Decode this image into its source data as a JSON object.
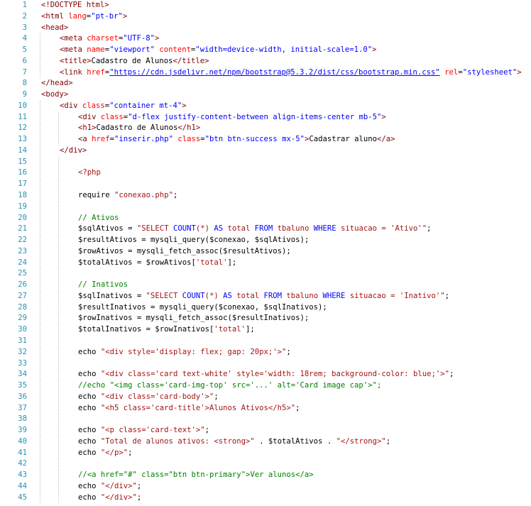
{
  "editor": {
    "colors": {
      "line_number": "#2b91af",
      "tag": "#800000",
      "attribute": "#ff0000",
      "string": "#0000ff",
      "comment": "#008000",
      "text": "#000000",
      "background": "#ffffff"
    },
    "lines": [
      {
        "n": "1",
        "tokens": [
          {
            "t": "tag",
            "v": "<!DOCTYPE html>"
          }
        ]
      },
      {
        "n": "2",
        "tokens": [
          {
            "t": "tag",
            "v": "<html "
          },
          {
            "t": "attr",
            "v": "lang"
          },
          {
            "t": "txt",
            "v": "="
          },
          {
            "t": "str",
            "v": "\"pt-br\""
          },
          {
            "t": "tag",
            "v": ">"
          }
        ]
      },
      {
        "n": "3",
        "tokens": [
          {
            "t": "tag",
            "v": "<head>"
          }
        ]
      },
      {
        "n": "4",
        "indent": 1,
        "tokens": [
          {
            "t": "tag",
            "v": "<meta "
          },
          {
            "t": "attr",
            "v": "charset"
          },
          {
            "t": "txt",
            "v": "="
          },
          {
            "t": "str",
            "v": "\"UTF-8\""
          },
          {
            "t": "tag",
            "v": ">"
          }
        ]
      },
      {
        "n": "5",
        "indent": 1,
        "tokens": [
          {
            "t": "tag",
            "v": "<meta "
          },
          {
            "t": "attr",
            "v": "name"
          },
          {
            "t": "txt",
            "v": "="
          },
          {
            "t": "str",
            "v": "\"viewport\""
          },
          {
            "t": "txt",
            "v": " "
          },
          {
            "t": "attr",
            "v": "content"
          },
          {
            "t": "txt",
            "v": "="
          },
          {
            "t": "str",
            "v": "\"width=device-width, initial-scale=1.0\""
          },
          {
            "t": "tag",
            "v": ">"
          }
        ]
      },
      {
        "n": "6",
        "indent": 1,
        "tokens": [
          {
            "t": "tag",
            "v": "<title>"
          },
          {
            "t": "txt",
            "v": "Cadastro de Alunos"
          },
          {
            "t": "tag",
            "v": "</title>"
          }
        ]
      },
      {
        "n": "7",
        "indent": 1,
        "tokens": [
          {
            "t": "tag",
            "v": "<link "
          },
          {
            "t": "attr",
            "v": "href"
          },
          {
            "t": "txt",
            "v": "="
          },
          {
            "t": "url",
            "v": "\"https://cdn.jsdelivr.net/npm/bootstrap@5.3.2/dist/css/bootstrap.min.css\""
          },
          {
            "t": "txt",
            "v": " "
          },
          {
            "t": "attr",
            "v": "rel"
          },
          {
            "t": "txt",
            "v": "="
          },
          {
            "t": "str",
            "v": "\"stylesheet\""
          },
          {
            "t": "tag",
            "v": ">"
          }
        ]
      },
      {
        "n": "8",
        "tokens": [
          {
            "t": "tag",
            "v": "</head>"
          }
        ]
      },
      {
        "n": "9",
        "tokens": [
          {
            "t": "tag",
            "v": "<body>"
          }
        ]
      },
      {
        "n": "10",
        "indent": 1,
        "tokens": [
          {
            "t": "tag",
            "v": "<div "
          },
          {
            "t": "attr",
            "v": "class"
          },
          {
            "t": "txt",
            "v": "="
          },
          {
            "t": "str",
            "v": "\"container mt-4\""
          },
          {
            "t": "tag",
            "v": ">"
          }
        ]
      },
      {
        "n": "11",
        "indent": 2,
        "tokens": [
          {
            "t": "tag",
            "v": "<div "
          },
          {
            "t": "attr",
            "v": "class"
          },
          {
            "t": "txt",
            "v": "="
          },
          {
            "t": "str",
            "v": "\"d-flex justify-content-between align-items-center mb-5\""
          },
          {
            "t": "tag",
            "v": ">"
          }
        ]
      },
      {
        "n": "12",
        "indent": 2,
        "tokens": [
          {
            "t": "tag",
            "v": "<h1>"
          },
          {
            "t": "txt",
            "v": "Cadastro de Alunos"
          },
          {
            "t": "tag",
            "v": "</h1>"
          }
        ]
      },
      {
        "n": "13",
        "indent": 2,
        "tokens": [
          {
            "t": "tag",
            "v": "<a "
          },
          {
            "t": "attr",
            "v": "href"
          },
          {
            "t": "txt",
            "v": "="
          },
          {
            "t": "str",
            "v": "\"inserir.php\""
          },
          {
            "t": "txt",
            "v": " "
          },
          {
            "t": "attr",
            "v": "class"
          },
          {
            "t": "txt",
            "v": "="
          },
          {
            "t": "str",
            "v": "\"btn btn-success mx-5\""
          },
          {
            "t": "tag",
            "v": ">"
          },
          {
            "t": "txt",
            "v": "Cadastrar aluno"
          },
          {
            "t": "tag",
            "v": "</a>"
          }
        ]
      },
      {
        "n": "14",
        "indent": 1,
        "tokens": [
          {
            "t": "tag",
            "v": "</div>"
          }
        ]
      },
      {
        "n": "15",
        "indent": 2,
        "tokens": []
      },
      {
        "n": "16",
        "indent": 2,
        "tokens": [
          {
            "t": "sstr",
            "v": "<?php"
          }
        ]
      },
      {
        "n": "17",
        "indent": 2,
        "tokens": []
      },
      {
        "n": "18",
        "indent": 2,
        "tokens": [
          {
            "t": "txt",
            "v": "require "
          },
          {
            "t": "sstr",
            "v": "\"conexao.php\""
          },
          {
            "t": "txt",
            "v": ";"
          }
        ]
      },
      {
        "n": "19",
        "indent": 2,
        "tokens": []
      },
      {
        "n": "20",
        "indent": 2,
        "tokens": [
          {
            "t": "cmt",
            "v": "// Ativos"
          }
        ]
      },
      {
        "n": "21",
        "indent": 2,
        "tokens": [
          {
            "t": "txt",
            "v": "$sqlAtivos = "
          },
          {
            "t": "sstr",
            "v": "\"SELECT "
          },
          {
            "t": "kw",
            "v": "COUNT"
          },
          {
            "t": "sstr",
            "v": "(*) "
          },
          {
            "t": "kw",
            "v": "AS"
          },
          {
            "t": "sstr",
            "v": " total "
          },
          {
            "t": "kw",
            "v": "FROM"
          },
          {
            "t": "sstr",
            "v": " tbaluno "
          },
          {
            "t": "kw",
            "v": "WHERE"
          },
          {
            "t": "sstr",
            "v": " situacao = 'Ativo'\""
          },
          {
            "t": "txt",
            "v": ";"
          }
        ]
      },
      {
        "n": "22",
        "indent": 2,
        "tokens": [
          {
            "t": "txt",
            "v": "$resultAtivos = mysqli_query($conexao, $sqlAtivos);"
          }
        ]
      },
      {
        "n": "23",
        "indent": 2,
        "tokens": [
          {
            "t": "txt",
            "v": "$rowAtivos = mysqli_fetch_assoc($resultAtivos);"
          }
        ]
      },
      {
        "n": "24",
        "indent": 2,
        "tokens": [
          {
            "t": "txt",
            "v": "$totalAtivos = $rowAtivos["
          },
          {
            "t": "sstr",
            "v": "'total'"
          },
          {
            "t": "txt",
            "v": "];"
          }
        ]
      },
      {
        "n": "25",
        "indent": 2,
        "tokens": []
      },
      {
        "n": "26",
        "indent": 2,
        "tokens": [
          {
            "t": "cmt",
            "v": "// Inativos"
          }
        ]
      },
      {
        "n": "27",
        "indent": 2,
        "tokens": [
          {
            "t": "txt",
            "v": "$sqlInativos = "
          },
          {
            "t": "sstr",
            "v": "\"SELECT "
          },
          {
            "t": "kw",
            "v": "COUNT"
          },
          {
            "t": "sstr",
            "v": "(*) "
          },
          {
            "t": "kw",
            "v": "AS"
          },
          {
            "t": "sstr",
            "v": " total "
          },
          {
            "t": "kw",
            "v": "FROM"
          },
          {
            "t": "sstr",
            "v": " tbaluno "
          },
          {
            "t": "kw",
            "v": "WHERE"
          },
          {
            "t": "sstr",
            "v": " situacao = 'Inativo'\""
          },
          {
            "t": "txt",
            "v": ";"
          }
        ]
      },
      {
        "n": "28",
        "indent": 2,
        "tokens": [
          {
            "t": "txt",
            "v": "$resultInativos = mysqli_query($conexao, $sqlInativos);"
          }
        ]
      },
      {
        "n": "29",
        "indent": 2,
        "tokens": [
          {
            "t": "txt",
            "v": "$rowInativos = mysqli_fetch_assoc($resultInativos);"
          }
        ]
      },
      {
        "n": "30",
        "indent": 2,
        "tokens": [
          {
            "t": "txt",
            "v": "$totalInativos = $rowInativos["
          },
          {
            "t": "sstr",
            "v": "'total'"
          },
          {
            "t": "txt",
            "v": "];"
          }
        ]
      },
      {
        "n": "31",
        "indent": 2,
        "tokens": []
      },
      {
        "n": "32",
        "indent": 2,
        "tokens": [
          {
            "t": "txt",
            "v": "echo "
          },
          {
            "t": "sstr",
            "v": "\"<div style='display: flex; gap: 20px;'>\""
          },
          {
            "t": "txt",
            "v": ";"
          }
        ]
      },
      {
        "n": "33",
        "indent": 2,
        "tokens": []
      },
      {
        "n": "34",
        "indent": 2,
        "tokens": [
          {
            "t": "txt",
            "v": "echo "
          },
          {
            "t": "sstr",
            "v": "\"<div class='card text-white' style='width: 18rem; background-color: blue;'>\""
          },
          {
            "t": "txt",
            "v": ";"
          }
        ]
      },
      {
        "n": "35",
        "indent": 2,
        "tokens": [
          {
            "t": "cmt",
            "v": "//echo \"<img class='card-img-top' src='...' alt='Card image cap'>\";"
          }
        ]
      },
      {
        "n": "36",
        "indent": 2,
        "tokens": [
          {
            "t": "txt",
            "v": "echo "
          },
          {
            "t": "sstr",
            "v": "\"<div class='card-body'>\""
          },
          {
            "t": "txt",
            "v": ";"
          }
        ]
      },
      {
        "n": "37",
        "indent": 2,
        "tokens": [
          {
            "t": "txt",
            "v": "echo "
          },
          {
            "t": "sstr",
            "v": "\"<h5 class='card-title'>Alunos Ativos</h5>\""
          },
          {
            "t": "txt",
            "v": ";"
          }
        ]
      },
      {
        "n": "38",
        "indent": 2,
        "tokens": []
      },
      {
        "n": "39",
        "indent": 2,
        "tokens": [
          {
            "t": "txt",
            "v": "echo "
          },
          {
            "t": "sstr",
            "v": "\"<p class='card-text'>\""
          },
          {
            "t": "txt",
            "v": ";"
          }
        ]
      },
      {
        "n": "40",
        "indent": 2,
        "tokens": [
          {
            "t": "txt",
            "v": "echo "
          },
          {
            "t": "sstr",
            "v": "\"Total de alunos ativos: <strong>\""
          },
          {
            "t": "txt",
            "v": " . $totalAtivos . "
          },
          {
            "t": "sstr",
            "v": "\"</strong>\""
          },
          {
            "t": "txt",
            "v": ";"
          }
        ]
      },
      {
        "n": "41",
        "indent": 2,
        "tokens": [
          {
            "t": "txt",
            "v": "echo "
          },
          {
            "t": "sstr",
            "v": "\"</p>\""
          },
          {
            "t": "txt",
            "v": ";"
          }
        ]
      },
      {
        "n": "42",
        "indent": 2,
        "tokens": []
      },
      {
        "n": "43",
        "indent": 2,
        "tokens": [
          {
            "t": "cmt",
            "v": "//<a href=\"#\" class=\"btn btn-primary\">Ver alunos</a>"
          }
        ]
      },
      {
        "n": "44",
        "indent": 2,
        "tokens": [
          {
            "t": "txt",
            "v": "echo "
          },
          {
            "t": "sstr",
            "v": "\"</div>\""
          },
          {
            "t": "txt",
            "v": ";"
          }
        ]
      },
      {
        "n": "45",
        "indent": 2,
        "tokens": [
          {
            "t": "txt",
            "v": "echo "
          },
          {
            "t": "sstr",
            "v": "\"</div>\""
          },
          {
            "t": "txt",
            "v": ";"
          }
        ]
      }
    ]
  }
}
